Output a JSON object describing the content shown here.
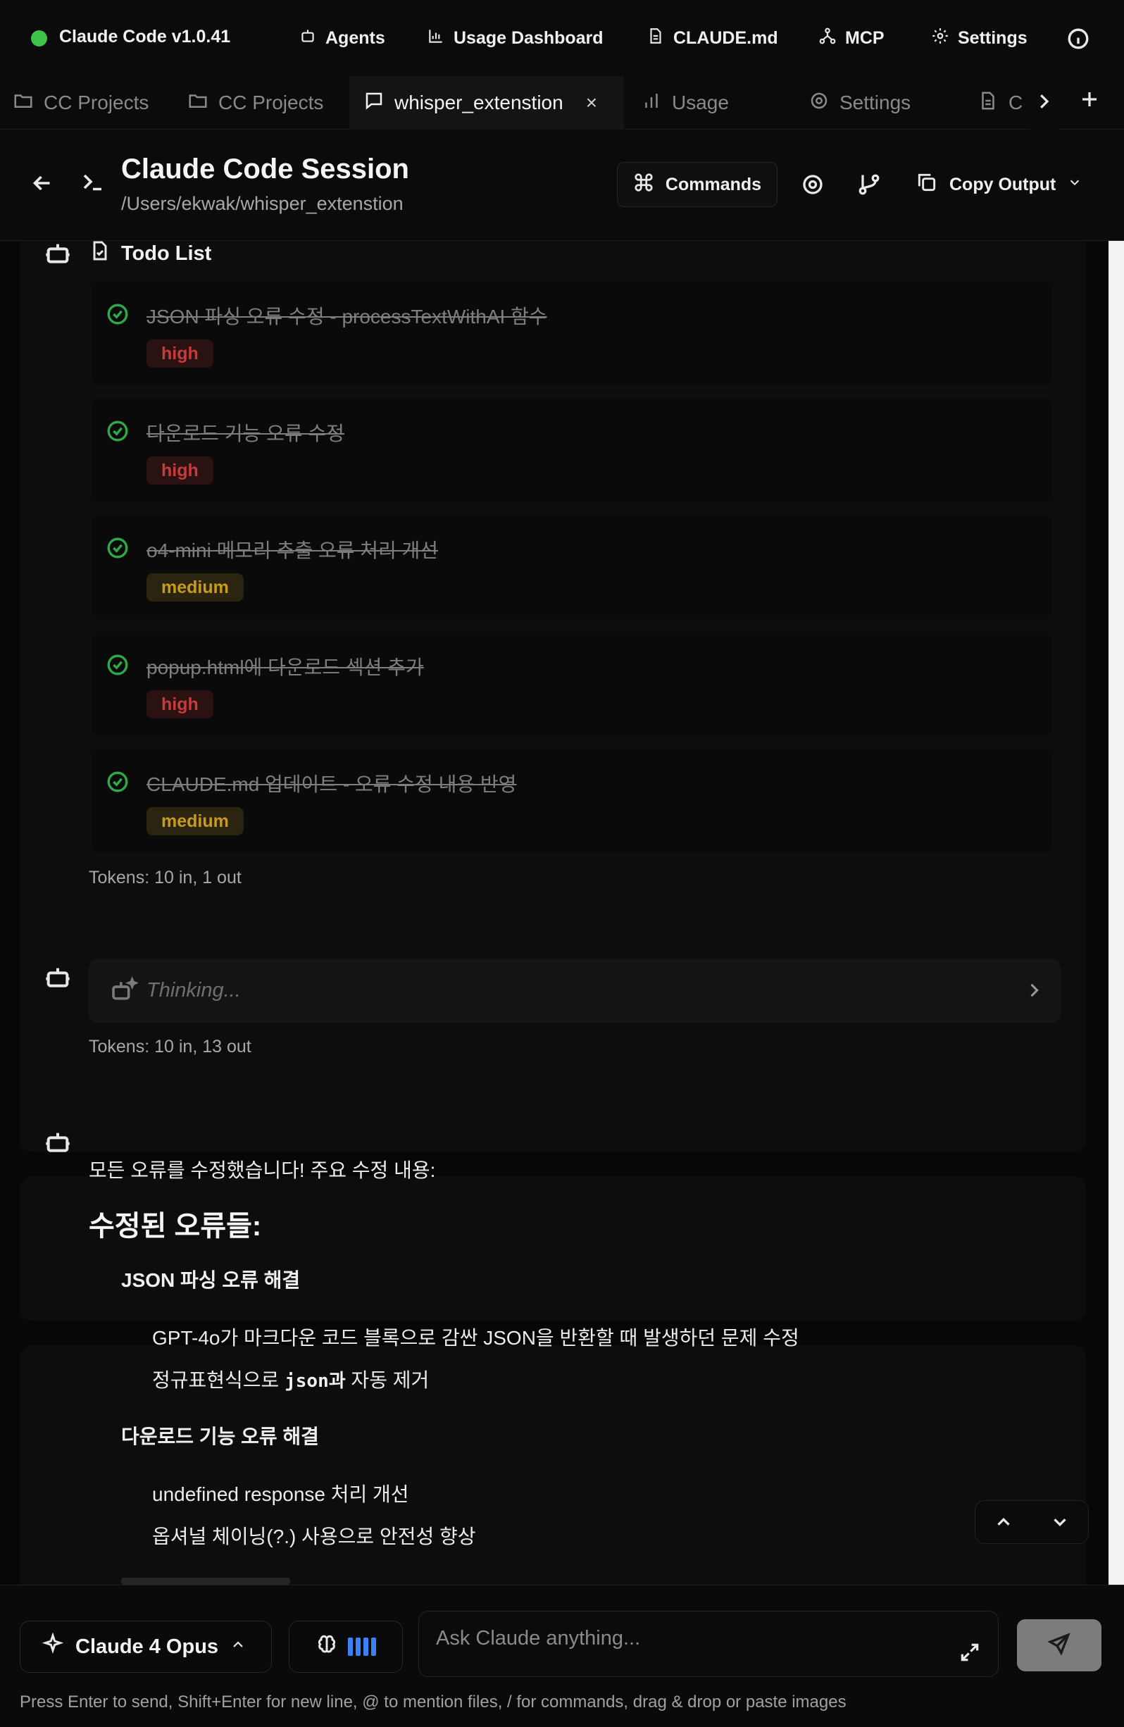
{
  "app": {
    "title": "Claude Code v1.0.41",
    "status_color": "#3ec24a"
  },
  "topnav": {
    "agents": "Agents",
    "usage_dashboard": "Usage Dashboard",
    "claude_md": "CLAUDE.md",
    "mcp": "MCP",
    "settings": "Settings"
  },
  "tabs": [
    {
      "label": "CC Projects",
      "icon": "folder-icon"
    },
    {
      "label": "CC Projects",
      "icon": "folder-icon"
    },
    {
      "label": "whisper_extenstion",
      "icon": "chat-bubble-icon",
      "active": true,
      "close": "×"
    },
    {
      "label": "Usage",
      "icon": "bar-chart-icon"
    },
    {
      "label": "Settings",
      "icon": "gear-icon"
    },
    {
      "label": "C",
      "icon": "document-icon"
    }
  ],
  "session": {
    "title": "Claude Code Session",
    "path": "/Users/ekwak/whisper_extenstion",
    "commands_label": "Commands",
    "copy_output_label": "Copy Output"
  },
  "todo": {
    "header": "Todo List",
    "items": [
      {
        "text": "JSON 파싱 오류 수정 - processTextWithAI 함수",
        "priority": "high",
        "done": true
      },
      {
        "text": "다운로드 기능 오류 수정",
        "priority": "high",
        "done": true
      },
      {
        "text": "o4-mini 메모리 추출 오류 처리 개선",
        "priority": "medium",
        "done": true
      },
      {
        "text": "popup.html에 다운로드 섹션 추가",
        "priority": "high",
        "done": true
      },
      {
        "text": "CLAUDE.md 업데이트 - 오류 수정 내용 반영",
        "priority": "medium",
        "done": true
      }
    ],
    "tokens": "Tokens: 10 in, 1 out"
  },
  "thinking": {
    "label": "Thinking...",
    "tokens": "Tokens: 10 in, 13 out"
  },
  "message": {
    "intro": "모든 오류를 수정했습니다! 주요 수정 내용:",
    "heading": "수정된 오류들:",
    "sections": [
      {
        "title": "JSON 파싱 오류 해결",
        "items": [
          "GPT-4o가 마크다운 코드 블록으로 감싼 JSON을 반환할 때 발생하던 문제 수정",
          {
            "before": "정규표현식으로 ",
            "code": "json과",
            "after": " 자동 제거"
          }
        ]
      },
      {
        "title": "다운로드 기능 오류 해결",
        "items": [
          "undefined response 처리 개선",
          "옵셔널 체이닝(?.) 사용으로 안전성 향상"
        ]
      }
    ]
  },
  "input": {
    "model": "Claude 4 Opus",
    "placeholder": "Ask Claude anything...",
    "hint": "Press Enter to send, Shift+Enter for new line, @ to mention files, / for commands, drag & drop or paste images",
    "thinking_level_bars": 4
  },
  "colors": {
    "high_text": "#c93a3a",
    "medium_text": "#c89a1e",
    "check": "#2fa84a",
    "accent_blue": "#3b82f6"
  }
}
